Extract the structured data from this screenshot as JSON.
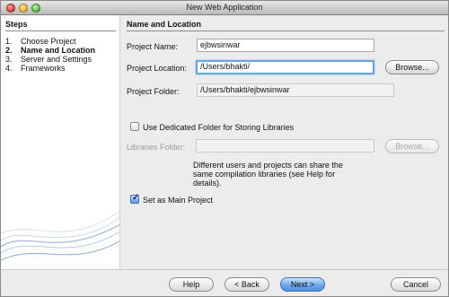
{
  "window": {
    "title": "New Web Application"
  },
  "steps": {
    "heading": "Steps",
    "items": [
      {
        "num": "1.",
        "label": "Choose Project"
      },
      {
        "num": "2.",
        "label": "Name and Location"
      },
      {
        "num": "3.",
        "label": "Server and Settings"
      },
      {
        "num": "4.",
        "label": "Frameworks"
      }
    ],
    "current_index": 1
  },
  "section": {
    "title": "Name and Location"
  },
  "form": {
    "project_name": {
      "label": "Project Name:",
      "value": "ejbwsinwar"
    },
    "project_location": {
      "label": "Project Location:",
      "value": "/Users/bhakti/",
      "browse_label": "Browse..."
    },
    "project_folder": {
      "label": "Project Folder:",
      "value": "/Users/bhakti/ejbwsinwar"
    },
    "dedicated_folder": {
      "label": "Use Dedicated Folder for Storing Libraries",
      "checked": false
    },
    "libraries_folder": {
      "label": "Libraries Folder:",
      "value": "",
      "browse_label": "Browse..."
    },
    "info_text": "Different users and projects can share the same compilation libraries (see Help for details).",
    "main_project": {
      "label": "Set as Main Project",
      "checked": true
    }
  },
  "buttons": {
    "help": "Help",
    "back": "< Back",
    "next": "Next >",
    "cancel": "Cancel"
  },
  "colors": {
    "focus_ring": "#6aa2e0",
    "default_button": "#4f8fe0"
  }
}
